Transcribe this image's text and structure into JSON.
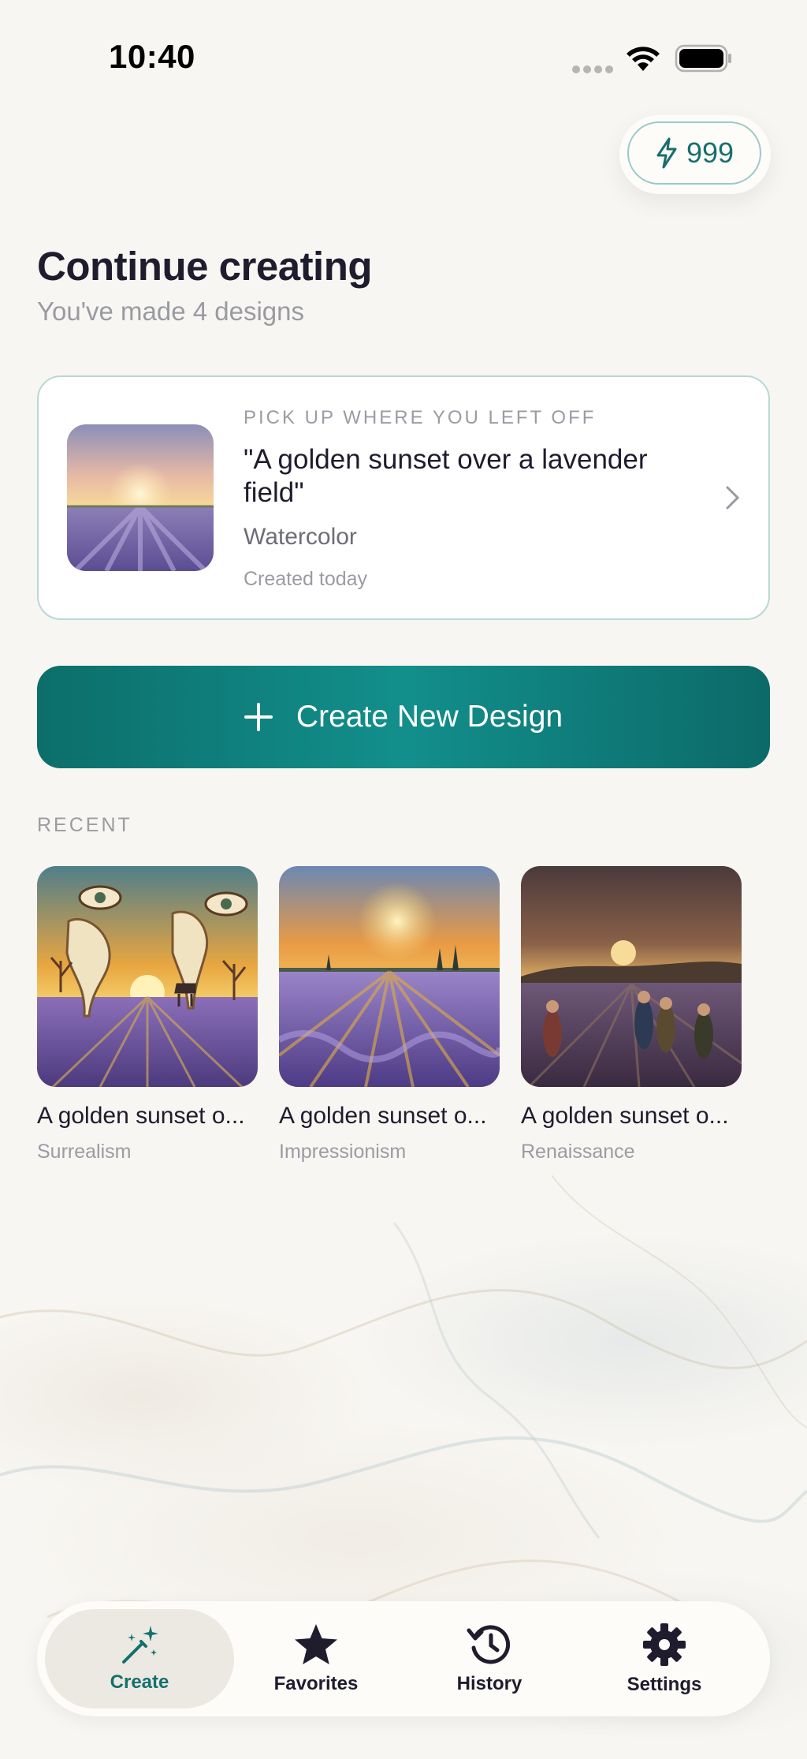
{
  "status_bar": {
    "time": "10:40",
    "icons": [
      "cellular-signal-icon",
      "wifi-icon",
      "battery-icon"
    ]
  },
  "credits": {
    "icon": "lightning-bolt-icon",
    "value": "999",
    "color": "#176f6d"
  },
  "header": {
    "title": "Continue creating",
    "subtitle": "You've made 4 designs"
  },
  "continue_card": {
    "eyebrow": "PICK UP WHERE YOU LEFT OFF",
    "prompt": "\"A golden sunset over a lavender field\"",
    "style": "Watercolor",
    "date": "Created today",
    "icon": "chevron-right-icon"
  },
  "create_button": {
    "label": "Create New Design",
    "icon": "plus-icon",
    "color": "#0e7a77"
  },
  "recent": {
    "label": "RECENT",
    "items": [
      {
        "title": "A golden sunset o...",
        "style": "Surrealism"
      },
      {
        "title": "A golden sunset o...",
        "style": "Impressionism"
      },
      {
        "title": "A golden sunset o...",
        "style": "Renaissance"
      }
    ]
  },
  "tab_bar": {
    "tabs": [
      {
        "label": "Create",
        "icon": "magic-wand-icon",
        "active": true
      },
      {
        "label": "Favorites",
        "icon": "star-icon",
        "active": false
      },
      {
        "label": "History",
        "icon": "history-clock-icon",
        "active": false
      },
      {
        "label": "Settings",
        "icon": "gear-icon",
        "active": false
      }
    ],
    "active_color": "#14706d"
  }
}
